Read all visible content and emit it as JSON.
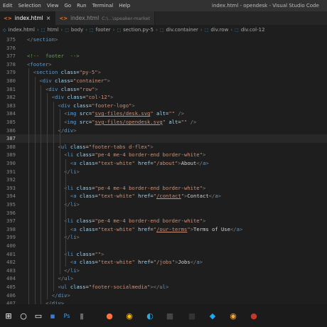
{
  "menu": [
    "Edit",
    "Selection",
    "View",
    "Go",
    "Run",
    "Terminal",
    "Help"
  ],
  "window_title": "index.html - opendesk - Visual Studio Code",
  "tabs": [
    {
      "label": "index.html",
      "close": "×",
      "active": true
    },
    {
      "label": "index.html",
      "sub": "C:\\...\\speaker-market",
      "active": false
    }
  ],
  "breadcrumb": [
    "index.html",
    "html",
    "body",
    "footer",
    "section.py-5",
    "div.container",
    "div.row",
    "div.col-12"
  ],
  "lines": [
    {
      "n": "375",
      "i": 0,
      "t": [
        [
          "t-punc",
          "</"
        ],
        [
          "t-tag",
          "section"
        ],
        [
          "t-punc",
          ">"
        ]
      ]
    },
    {
      "n": "376",
      "i": 0,
      "t": []
    },
    {
      "n": "377",
      "i": 0,
      "t": [
        [
          "t-com",
          "<!--  footer  -->"
        ]
      ]
    },
    {
      "n": "378",
      "i": 0,
      "t": [
        [
          "t-punc",
          "<"
        ],
        [
          "t-tag",
          "footer"
        ],
        [
          "t-punc",
          ">"
        ]
      ]
    },
    {
      "n": "379",
      "i": 1,
      "t": [
        [
          "t-punc",
          "<"
        ],
        [
          "t-tag",
          "section"
        ],
        [
          "t-txt",
          " "
        ],
        [
          "t-attr",
          "class"
        ],
        [
          "t-txt",
          "="
        ],
        [
          "t-val",
          "\"py-5\""
        ],
        [
          "t-punc",
          ">"
        ]
      ]
    },
    {
      "n": "380",
      "i": 2,
      "t": [
        [
          "t-punc",
          "<"
        ],
        [
          "t-tag",
          "div"
        ],
        [
          "t-txt",
          " "
        ],
        [
          "t-attr",
          "class"
        ],
        [
          "t-txt",
          "="
        ],
        [
          "t-val",
          "\"container\""
        ],
        [
          "t-punc",
          ">"
        ]
      ]
    },
    {
      "n": "381",
      "i": 3,
      "t": [
        [
          "t-punc",
          "<"
        ],
        [
          "t-tag",
          "div"
        ],
        [
          "t-txt",
          " "
        ],
        [
          "t-attr",
          "class"
        ],
        [
          "t-txt",
          "="
        ],
        [
          "t-val",
          "\"row\""
        ],
        [
          "t-punc",
          ">"
        ]
      ]
    },
    {
      "n": "382",
      "i": 4,
      "t": [
        [
          "t-punc",
          "<"
        ],
        [
          "t-tag",
          "div"
        ],
        [
          "t-txt",
          " "
        ],
        [
          "t-attr",
          "class"
        ],
        [
          "t-txt",
          "="
        ],
        [
          "t-val",
          "\"col-12\""
        ],
        [
          "t-punc",
          ">"
        ]
      ]
    },
    {
      "n": "383",
      "i": 5,
      "t": [
        [
          "t-punc",
          "<"
        ],
        [
          "t-tag",
          "div"
        ],
        [
          "t-txt",
          " "
        ],
        [
          "t-attr",
          "class"
        ],
        [
          "t-txt",
          "="
        ],
        [
          "t-val",
          "\"footer-logo\""
        ],
        [
          "t-punc",
          ">"
        ]
      ]
    },
    {
      "n": "384",
      "i": 6,
      "t": [
        [
          "t-punc",
          "<"
        ],
        [
          "t-tag",
          "img"
        ],
        [
          "t-txt",
          " "
        ],
        [
          "t-attr",
          "src"
        ],
        [
          "t-txt",
          "="
        ],
        [
          "t-val",
          "\""
        ],
        [
          "t-link",
          "svg-files/desk.svg"
        ],
        [
          "t-val",
          "\""
        ],
        [
          "t-txt",
          " "
        ],
        [
          "t-attr",
          "alt"
        ],
        [
          "t-txt",
          "="
        ],
        [
          "t-val",
          "\"\""
        ],
        [
          "t-txt",
          " "
        ],
        [
          "t-punc",
          "/>"
        ]
      ]
    },
    {
      "n": "385",
      "i": 6,
      "t": [
        [
          "t-punc",
          "<"
        ],
        [
          "t-tag",
          "img"
        ],
        [
          "t-txt",
          " "
        ],
        [
          "t-attr",
          "src"
        ],
        [
          "t-txt",
          "="
        ],
        [
          "t-val",
          "\""
        ],
        [
          "t-link",
          "svg-files/opendesk.svg"
        ],
        [
          "t-val",
          "\""
        ],
        [
          "t-txt",
          " "
        ],
        [
          "t-attr",
          "alt"
        ],
        [
          "t-txt",
          "="
        ],
        [
          "t-val",
          "\"\""
        ],
        [
          "t-txt",
          " "
        ],
        [
          "t-punc",
          "/>"
        ]
      ]
    },
    {
      "n": "386",
      "i": 5,
      "t": [
        [
          "t-punc",
          "</"
        ],
        [
          "t-tag",
          "div"
        ],
        [
          "t-punc",
          ">"
        ]
      ]
    },
    {
      "n": "387",
      "i": 0,
      "t": [],
      "current": true
    },
    {
      "n": "388",
      "i": 5,
      "t": [
        [
          "t-punc",
          "<"
        ],
        [
          "t-tag",
          "ul"
        ],
        [
          "t-txt",
          " "
        ],
        [
          "t-attr",
          "class"
        ],
        [
          "t-txt",
          "="
        ],
        [
          "t-val",
          "\"footer-tabs d-flex\""
        ],
        [
          "t-punc",
          ">"
        ]
      ]
    },
    {
      "n": "389",
      "i": 6,
      "t": [
        [
          "t-punc",
          "<"
        ],
        [
          "t-tag",
          "li"
        ],
        [
          "t-txt",
          " "
        ],
        [
          "t-attr",
          "class"
        ],
        [
          "t-txt",
          "="
        ],
        [
          "t-val",
          "\"pe-4 me-4 border-end border-white\""
        ],
        [
          "t-punc",
          ">"
        ]
      ]
    },
    {
      "n": "390",
      "i": 7,
      "t": [
        [
          "t-punc",
          "<"
        ],
        [
          "t-tag",
          "a"
        ],
        [
          "t-txt",
          " "
        ],
        [
          "t-attr",
          "class"
        ],
        [
          "t-txt",
          "="
        ],
        [
          "t-val",
          "\"text-white\""
        ],
        [
          "t-txt",
          " "
        ],
        [
          "t-attr",
          "href"
        ],
        [
          "t-txt",
          "="
        ],
        [
          "t-val",
          "\"/about\""
        ],
        [
          "t-punc",
          ">"
        ],
        [
          "t-txt",
          "About"
        ],
        [
          "t-punc",
          "</"
        ],
        [
          "t-tag",
          "a"
        ],
        [
          "t-punc",
          ">"
        ]
      ]
    },
    {
      "n": "391",
      "i": 6,
      "t": [
        [
          "t-punc",
          "</"
        ],
        [
          "t-tag",
          "li"
        ],
        [
          "t-punc",
          ">"
        ]
      ]
    },
    {
      "n": "392",
      "i": 0,
      "t": []
    },
    {
      "n": "393",
      "i": 6,
      "t": [
        [
          "t-punc",
          "<"
        ],
        [
          "t-tag",
          "li"
        ],
        [
          "t-txt",
          " "
        ],
        [
          "t-attr",
          "class"
        ],
        [
          "t-txt",
          "="
        ],
        [
          "t-val",
          "\"pe-4 me-4 border-end border-white\""
        ],
        [
          "t-punc",
          ">"
        ]
      ]
    },
    {
      "n": "394",
      "i": 7,
      "t": [
        [
          "t-punc",
          "<"
        ],
        [
          "t-tag",
          "a"
        ],
        [
          "t-txt",
          " "
        ],
        [
          "t-attr",
          "class"
        ],
        [
          "t-txt",
          "="
        ],
        [
          "t-val",
          "\"text-white\""
        ],
        [
          "t-txt",
          " "
        ],
        [
          "t-attr",
          "href"
        ],
        [
          "t-txt",
          "="
        ],
        [
          "t-val",
          "\""
        ],
        [
          "t-link",
          "/contact"
        ],
        [
          "t-val",
          "\""
        ],
        [
          "t-punc",
          ">"
        ],
        [
          "t-txt",
          "Contact"
        ],
        [
          "t-punc",
          "</"
        ],
        [
          "t-tag",
          "a"
        ],
        [
          "t-punc",
          ">"
        ]
      ]
    },
    {
      "n": "395",
      "i": 6,
      "t": [
        [
          "t-punc",
          "</"
        ],
        [
          "t-tag",
          "li"
        ],
        [
          "t-punc",
          ">"
        ]
      ]
    },
    {
      "n": "396",
      "i": 0,
      "t": []
    },
    {
      "n": "397",
      "i": 6,
      "t": [
        [
          "t-punc",
          "<"
        ],
        [
          "t-tag",
          "li"
        ],
        [
          "t-txt",
          " "
        ],
        [
          "t-attr",
          "class"
        ],
        [
          "t-txt",
          "="
        ],
        [
          "t-val",
          "\"pe-4 me-4 border-end border-white\""
        ],
        [
          "t-punc",
          ">"
        ]
      ]
    },
    {
      "n": "398",
      "i": 7,
      "t": [
        [
          "t-punc",
          "<"
        ],
        [
          "t-tag",
          "a"
        ],
        [
          "t-txt",
          " "
        ],
        [
          "t-attr",
          "class"
        ],
        [
          "t-txt",
          "="
        ],
        [
          "t-val",
          "\"text-white\""
        ],
        [
          "t-txt",
          " "
        ],
        [
          "t-attr",
          "href"
        ],
        [
          "t-txt",
          "="
        ],
        [
          "t-val",
          "\""
        ],
        [
          "t-link",
          "/our-terms"
        ],
        [
          "t-val",
          "\""
        ],
        [
          "t-punc",
          ">"
        ],
        [
          "t-txt",
          "Terms of Use"
        ],
        [
          "t-punc",
          "</"
        ],
        [
          "t-tag",
          "a"
        ],
        [
          "t-punc",
          ">"
        ]
      ]
    },
    {
      "n": "399",
      "i": 6,
      "t": [
        [
          "t-punc",
          "</"
        ],
        [
          "t-tag",
          "li"
        ],
        [
          "t-punc",
          ">"
        ]
      ]
    },
    {
      "n": "400",
      "i": 0,
      "t": []
    },
    {
      "n": "401",
      "i": 6,
      "t": [
        [
          "t-punc",
          "<"
        ],
        [
          "t-tag",
          "li"
        ],
        [
          "t-txt",
          " "
        ],
        [
          "t-attr",
          "class"
        ],
        [
          "t-txt",
          "="
        ],
        [
          "t-val",
          "\"\""
        ],
        [
          "t-punc",
          ">"
        ]
      ]
    },
    {
      "n": "402",
      "i": 7,
      "t": [
        [
          "t-punc",
          "<"
        ],
        [
          "t-tag",
          "a"
        ],
        [
          "t-txt",
          " "
        ],
        [
          "t-attr",
          "class"
        ],
        [
          "t-txt",
          "="
        ],
        [
          "t-val",
          "\"text-white\""
        ],
        [
          "t-txt",
          " "
        ],
        [
          "t-attr",
          "href"
        ],
        [
          "t-txt",
          "="
        ],
        [
          "t-val",
          "\"/jobs\""
        ],
        [
          "t-punc",
          ">"
        ],
        [
          "t-txt",
          "Jobs"
        ],
        [
          "t-punc",
          "</"
        ],
        [
          "t-tag",
          "a"
        ],
        [
          "t-punc",
          ">"
        ]
      ]
    },
    {
      "n": "403",
      "i": 6,
      "t": [
        [
          "t-punc",
          "</"
        ],
        [
          "t-tag",
          "li"
        ],
        [
          "t-punc",
          ">"
        ]
      ]
    },
    {
      "n": "404",
      "i": 5,
      "t": [
        [
          "t-punc",
          "</"
        ],
        [
          "t-tag",
          "ul"
        ],
        [
          "t-punc",
          ">"
        ]
      ]
    },
    {
      "n": "405",
      "i": 5,
      "t": [
        [
          "t-punc",
          "<"
        ],
        [
          "t-tag",
          "ul"
        ],
        [
          "t-txt",
          " "
        ],
        [
          "t-attr",
          "class"
        ],
        [
          "t-txt",
          "="
        ],
        [
          "t-val",
          "\"footer-socialmedia\""
        ],
        [
          "t-punc",
          "></"
        ],
        [
          "t-tag",
          "ul"
        ],
        [
          "t-punc",
          ">"
        ]
      ]
    },
    {
      "n": "406",
      "i": 4,
      "t": [
        [
          "t-punc",
          "</"
        ],
        [
          "t-tag",
          "div"
        ],
        [
          "t-punc",
          ">"
        ]
      ]
    },
    {
      "n": "407",
      "i": 3,
      "t": [
        [
          "t-punc",
          "</"
        ],
        [
          "t-tag",
          "div"
        ],
        [
          "t-punc",
          ">"
        ]
      ]
    }
  ],
  "taskbar": [
    {
      "name": "windows-start-icon",
      "glyph": "⊞",
      "color": "#ffffff"
    },
    {
      "name": "search-icon",
      "glyph": "○",
      "color": "#ffffff"
    },
    {
      "name": "task-view-icon",
      "glyph": "▭",
      "color": "#ffffff"
    },
    {
      "name": "explorer-icon",
      "glyph": "▪",
      "color": "#3a7bd5"
    },
    {
      "name": "photoshop-icon",
      "glyph": "Ps",
      "color": "#31a8ff"
    },
    {
      "name": "app-icon",
      "glyph": "▮",
      "color": "#666666"
    },
    {
      "name": "firefox-icon",
      "glyph": "●",
      "color": "#ff7139"
    },
    {
      "name": "chrome-icon",
      "glyph": "◉",
      "color": "#fbbc04"
    },
    {
      "name": "edge-icon",
      "glyph": "◐",
      "color": "#2fa8e0"
    },
    {
      "name": "app2-icon",
      "glyph": "■",
      "color": "#444444"
    },
    {
      "name": "app3-icon",
      "glyph": "■",
      "color": "#333333"
    },
    {
      "name": "vscode-icon",
      "glyph": "◆",
      "color": "#22a7f2"
    },
    {
      "name": "app4-icon",
      "glyph": "◉",
      "color": "#f4a83a"
    },
    {
      "name": "app5-icon",
      "glyph": "●",
      "color": "#c0392b"
    }
  ]
}
